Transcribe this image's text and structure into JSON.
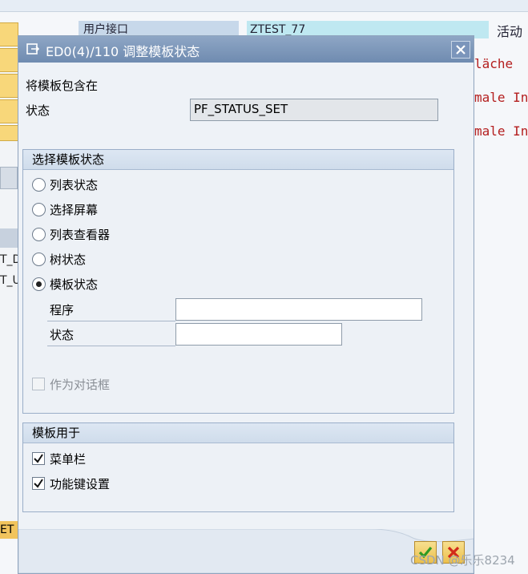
{
  "background": {
    "header_label": "用户接口",
    "header_value": "ZTEST_77",
    "right_label": "活动",
    "red_lines": [
      "läche",
      "male In",
      "male In"
    ],
    "left_texts": [
      "T_D",
      "T_U"
    ],
    "left_bottom": "ET"
  },
  "dialog": {
    "title": "ED0(4)/110 调整模板状态",
    "include_label": "将模板包含在",
    "status_label": "状态",
    "status_value": "PF_STATUS_SET",
    "select_group": {
      "title": "选择模板状态",
      "options": [
        "列表状态",
        "选择屏幕",
        "列表查看器",
        "树状态",
        "模板状态"
      ],
      "selected": "模板状态",
      "program_label": "程序",
      "program_value": "",
      "state_label": "状态",
      "state_value": "",
      "dialog_box_label": "作为对话框",
      "dialog_box_checked": false
    },
    "usage_group": {
      "title": "模板用于",
      "items": [
        {
          "label": "菜单栏",
          "checked": true
        },
        {
          "label": "功能键设置",
          "checked": true
        }
      ]
    }
  },
  "watermark": "CSDN @乐乐8234"
}
